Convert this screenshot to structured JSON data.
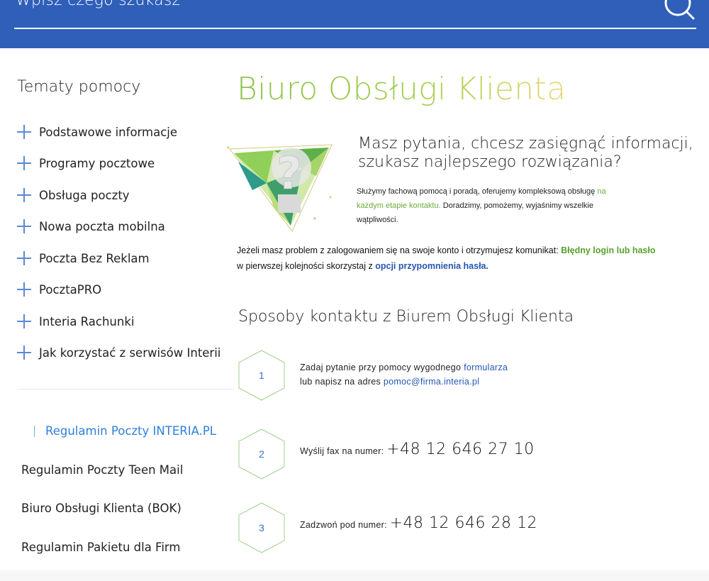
{
  "search": {
    "placeholder": "Wpisz czego szukasz"
  },
  "sidebar": {
    "title": "Tematy pomocy",
    "topics": [
      "Podstawowe informacje",
      "Programy pocztowe",
      "Obsługa poczty",
      "Nowa poczta mobilna",
      "Poczta Bez Reklam",
      "PocztaPRO",
      "Interia Rachunki",
      "Jak korzystać z serwisów Interii"
    ],
    "regulations": [
      "Regulamin Poczty INTERIA.PL",
      "Regulamin Poczty Teen Mail",
      "Biuro Obsługi Klienta (BOK)",
      "Regulamin Pakietu dla Firm"
    ]
  },
  "main": {
    "title": "Biuro Obsługi Klienta",
    "lead": "Masz pytania, chcesz zasięgnąć informacji, szukasz najlepszego rozwiązania?",
    "intro_1": "Służymy fachową pomocą i poradą, oferujemy kompleksową obsługę",
    "intro_green": "na każdym etapie kontaktu.",
    "intro_2": "Doradzimy, pomożemy, wyjaśnimy wszelkie wątpliwości.",
    "warn_1": "Jeżeli masz problem z zalogowaniem się na swoje konto i otrzymujesz komunikat:",
    "warn_green": "Błędny login lub hasło",
    "warn_2": "w pierwszej kolejności skorzystaj z",
    "warn_link": "opcji przypomnienia hasła.",
    "section_title": "Sposoby kontaktu z Biurem Obsługi Klienta",
    "contacts": [
      {
        "num": "1",
        "text_a": "Zadaj pytanie przy pomocy wygodnego",
        "link_a": "formularza",
        "text_b": "lub napisz na adres",
        "link_b": "pomoc@firma.interia.pl"
      },
      {
        "num": "2",
        "label": "Wyślij fax na numer",
        "phone": "+48 12 646 27 10"
      },
      {
        "num": "3",
        "label": "Zadzwoń pod numer",
        "phone": "+48 12 646 28 12"
      }
    ]
  },
  "colors": {
    "header": "#2f5fb8",
    "accent_green": "#6aac3b",
    "link_blue": "#2456b0",
    "active_link": "#2f7fd8"
  }
}
